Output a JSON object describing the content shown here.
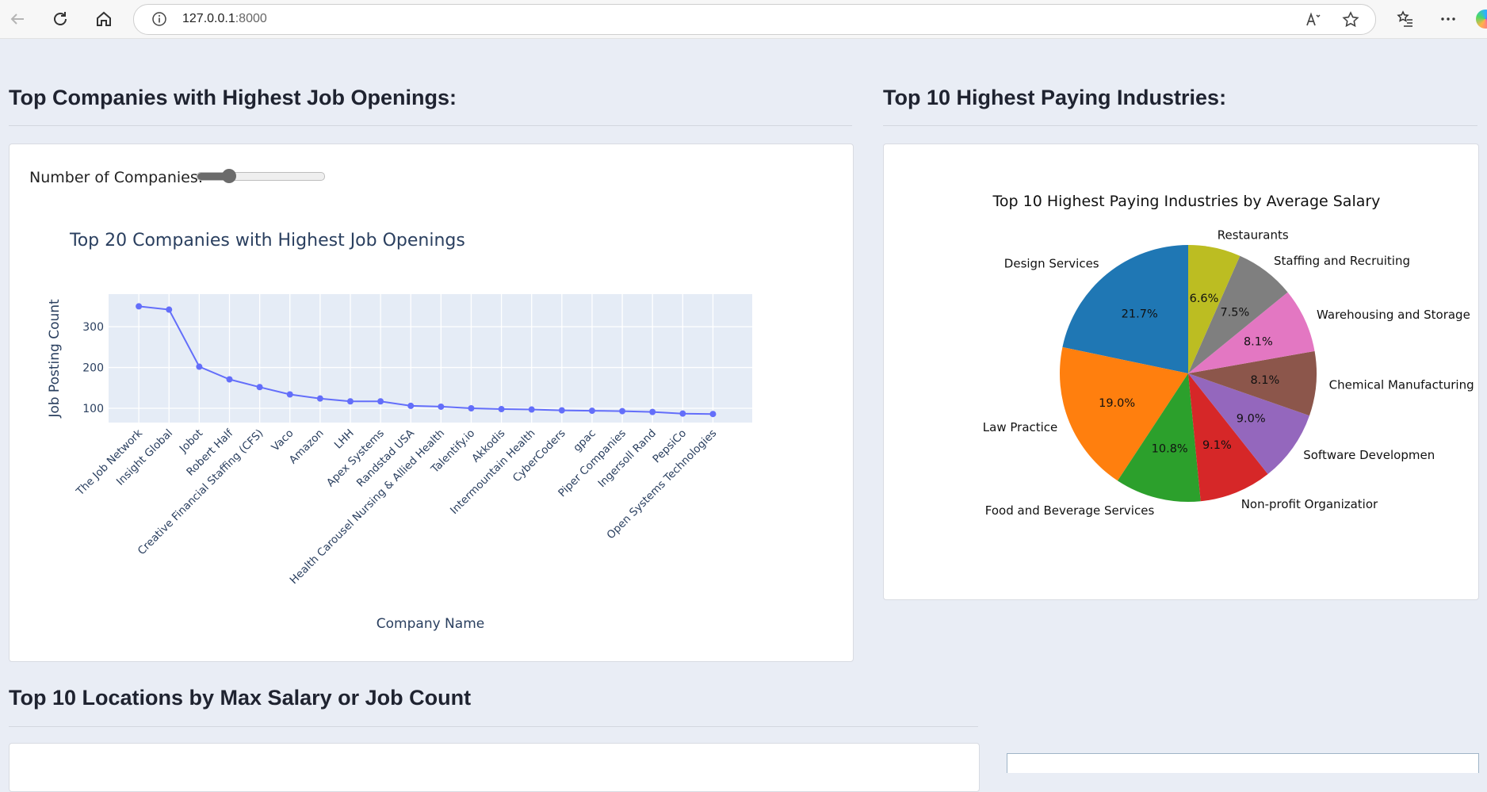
{
  "browser": {
    "url_host": "127.0.0.1",
    "url_port": ":8000"
  },
  "sections": {
    "companies_title": "Top Companies with Highest Job Openings:",
    "industries_title": "Top 10 Highest Paying Industries:",
    "locations_title": "Top 10 Locations by Max Salary or Job Count"
  },
  "slider": {
    "label": "Number of Companies:",
    "value": 20,
    "min": 1,
    "max": 100
  },
  "colors": {
    "line": "#636efa",
    "plot_bg": "#e5ecf6",
    "plotly_text": "#2a3f5f",
    "pie": [
      "#1f77b4",
      "#ff7f0e",
      "#2ca02c",
      "#d62728",
      "#9467bd",
      "#8c564b",
      "#e377c2",
      "#7f7f7f",
      "#bcbd22"
    ]
  },
  "chart_data": [
    {
      "type": "line",
      "title": "Top 20 Companies with Highest Job Openings",
      "xlabel": "Company Name",
      "ylabel": "Job Posting Count",
      "categories": [
        "The Job Network",
        "Insight Global",
        "Jobot",
        "Robert Half",
        "Creative Financial Staffing (CFS)",
        "Vaco",
        "Amazon",
        "LHH",
        "Apex Systems",
        "Randstad USA",
        "Health Carousel Nursing & Allied Health",
        "Talentify.io",
        "Akkodis",
        "Intermountain Health",
        "CyberCoders",
        "gpac",
        "Piper Companies",
        "Ingersoll Rand",
        "PepsiCo",
        "Open Systems Technologies"
      ],
      "values": [
        350,
        342,
        202,
        171,
        152,
        134,
        124,
        117,
        117,
        106,
        104,
        100,
        98,
        97,
        95,
        94,
        93,
        91,
        87,
        86
      ],
      "yticks": [
        100,
        200,
        300
      ],
      "ylim": [
        65,
        380
      ],
      "grid": true
    },
    {
      "type": "pie",
      "title": "Top 10 Highest Paying Industries by Average Salary",
      "slices": [
        {
          "label": "Design Services",
          "pct": "21.7%",
          "value": 21.7
        },
        {
          "label": "Law Practice",
          "pct": "19.0%",
          "value": 19.0
        },
        {
          "label": "Food and Beverage Services",
          "pct": "10.8%",
          "value": 10.8
        },
        {
          "label": "Non-profit Organizatior",
          "pct": "9.1%",
          "value": 9.1
        },
        {
          "label": "Software Developmen",
          "pct": "9.0%",
          "value": 9.0
        },
        {
          "label": "Chemical Manufacturing",
          "pct": "8.1%",
          "value": 8.1
        },
        {
          "label": "Warehousing and Storage",
          "pct": "8.1%",
          "value": 8.1
        },
        {
          "label": "Staffing and Recruiting",
          "pct": "7.5%",
          "value": 7.5
        },
        {
          "label": "Restaurants",
          "pct": "6.6%",
          "value": 6.6
        }
      ]
    }
  ]
}
